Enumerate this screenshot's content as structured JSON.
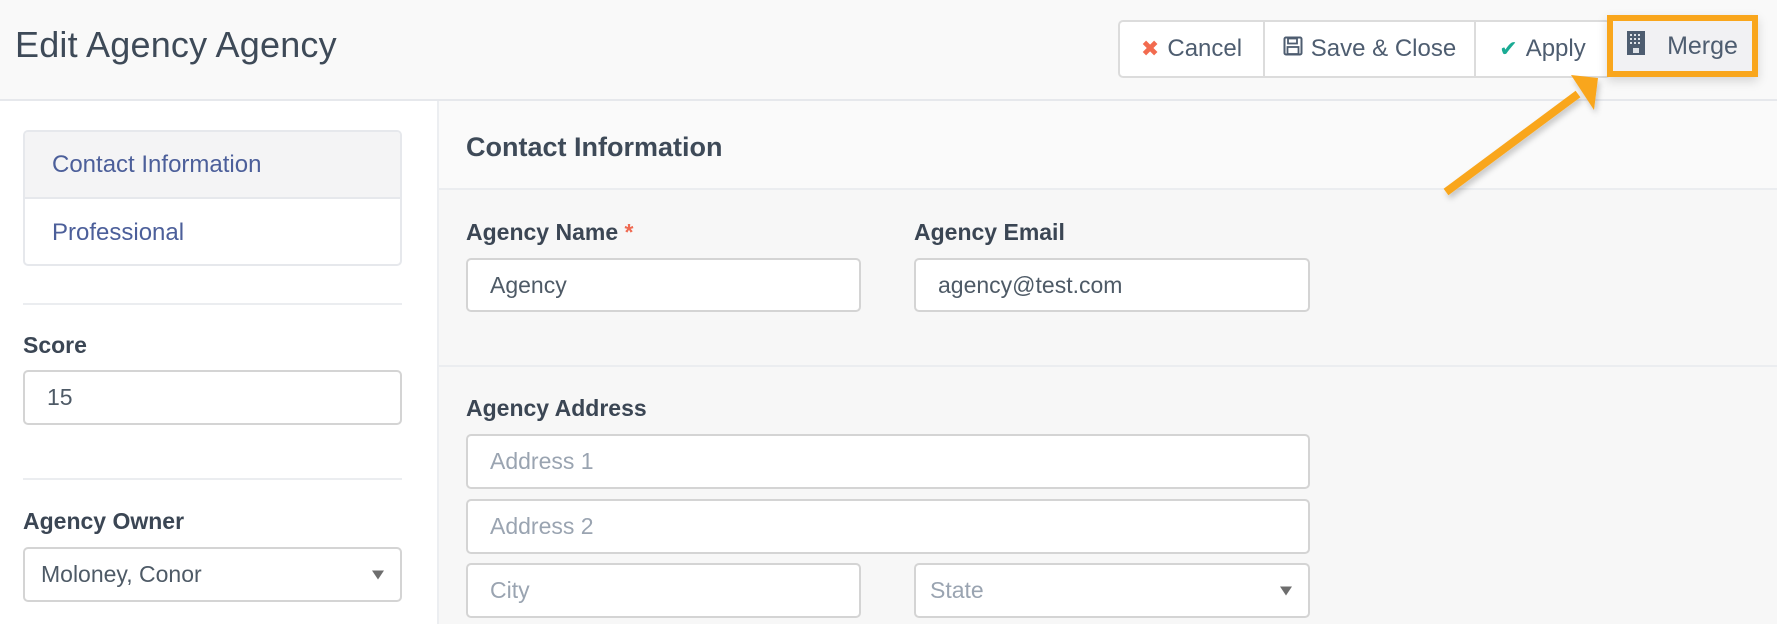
{
  "header": {
    "title": "Edit Agency Agency",
    "buttons": {
      "cancel": {
        "label": "Cancel",
        "icon": "close-icon"
      },
      "save_close": {
        "label": "Save & Close",
        "icon": "floppy-disk-icon"
      },
      "apply": {
        "label": "Apply",
        "icon": "checkmark-icon"
      },
      "merge": {
        "label": "Merge",
        "icon": "building-icon"
      }
    }
  },
  "annotation": {
    "highlight_color": "#f9a61c",
    "target": "Merge"
  },
  "sidebar": {
    "nav": [
      {
        "label": "Contact Information",
        "active": true
      },
      {
        "label": "Professional",
        "active": false
      }
    ],
    "score": {
      "label": "Score",
      "value": "15"
    },
    "owner": {
      "label": "Agency Owner",
      "value": "Moloney, Conor"
    }
  },
  "main": {
    "section_title": "Contact Information",
    "agency_name": {
      "label": "Agency Name",
      "required_mark": "*",
      "value": "Agency"
    },
    "agency_email": {
      "label": "Agency Email",
      "value": "agency@test.com"
    },
    "address": {
      "label": "Agency Address",
      "address1_placeholder": "Address 1",
      "address2_placeholder": "Address 2",
      "city_placeholder": "City",
      "state_placeholder": "State"
    }
  },
  "colors": {
    "accent_blue": "#4c5f9a",
    "cancel_red": "#f26b4f",
    "apply_green": "#1aab94",
    "required_red": "#ef6a52"
  }
}
